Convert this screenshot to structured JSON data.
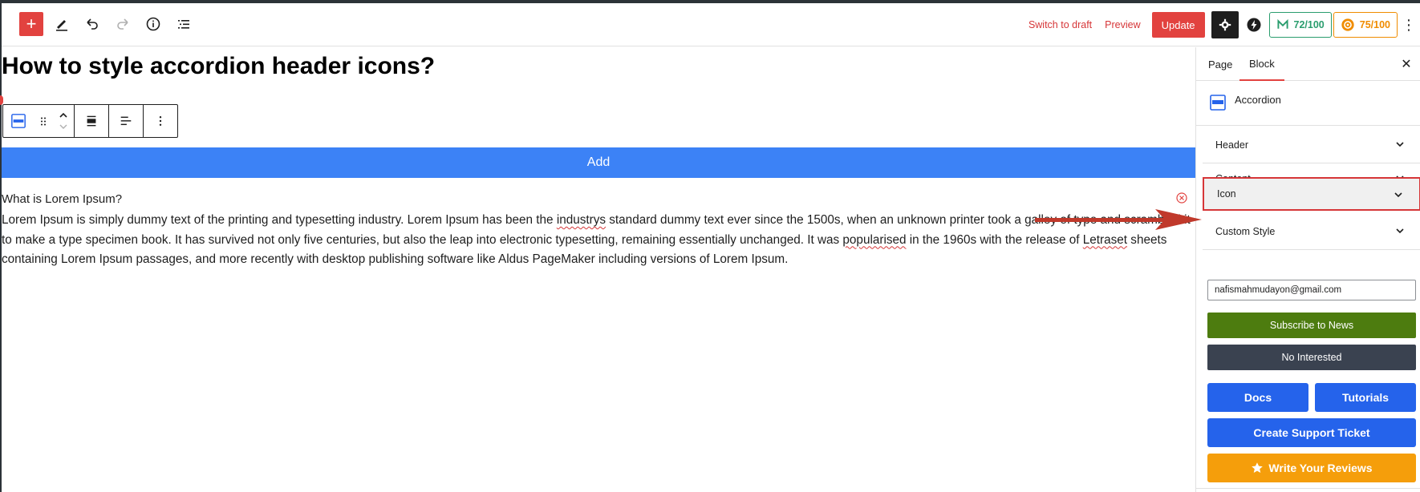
{
  "toolbar": {
    "plus_label": "+",
    "switch_to_draft": "Switch to draft",
    "preview": "Preview",
    "update": "Update",
    "score_seo": "72/100",
    "score_readability": "75/100",
    "more": "⋮"
  },
  "editor": {
    "post_title": "How to style accordion header icons?",
    "add_button": "Add",
    "accordion_question": "What is Lorem Ipsum?",
    "accordion_body": {
      "line1_a": "Lorem Ipsum is simply dummy text of the printing and typesetting industry. Lorem Ipsum has been the ",
      "line1_spell": "industrys",
      "line1_b": " standard dummy text ever since the 1500s, when an unknown printer took a galley of type and scrambled it to make a type specimen book. It has survived not only five centuries, but also the leap into electronic typesetting, remaining essentially unchanged. It was ",
      "spell2": "popularised",
      "part3": " in the 1960s with the release of ",
      "spell3": "Letraset",
      "part4": " sheets containing Lorem Ipsum passages, and more recently with desktop publishing software like Aldus PageMaker including versions of Lorem Ipsum."
    }
  },
  "sidebar": {
    "tabs": [
      {
        "label": "Page"
      },
      {
        "label": "Block"
      }
    ],
    "close": "✕",
    "block_name": "Accordion",
    "panels": [
      {
        "label": "Header"
      },
      {
        "label": "Content"
      },
      {
        "label": "Icon"
      },
      {
        "label": "Custom Style"
      }
    ],
    "email_value": "nafismahmudayon@gmail.com",
    "subscribe": "Subscribe to News",
    "not_interested": "No Interested",
    "docs": "Docs",
    "tutorials": "Tutorials",
    "support": "Create Support Ticket",
    "reviews": "Write Your Reviews"
  },
  "colors": {
    "brand_red": "#e2423f",
    "add_blue": "#3c82f6",
    "action_blue": "#2563eb",
    "subscribe_green": "#4d7c0f",
    "reviews_orange": "#f59e0b",
    "score_green": "#2a9d6e",
    "score_orange": "#f08c00",
    "annotation_arrow": "#c0392b"
  },
  "icons": {
    "undo": "undo-icon",
    "redo": "redo-icon",
    "info": "info-icon",
    "list_view": "list-view-icon",
    "pencil": "pencil-icon",
    "gear": "gear-icon",
    "bolt": "bolt-icon"
  }
}
